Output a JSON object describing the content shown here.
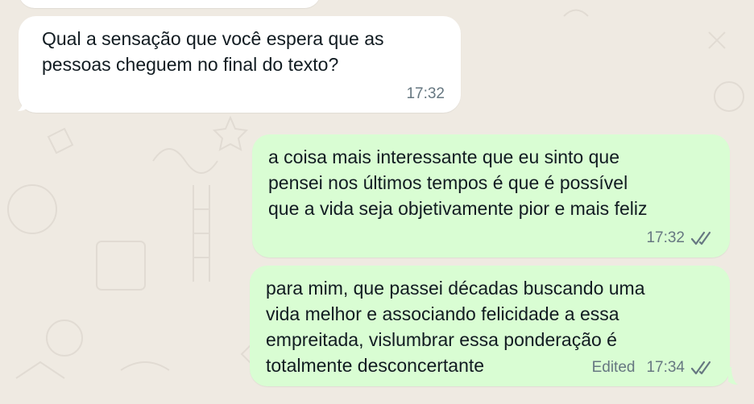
{
  "colors": {
    "wallpaper": "#efeae2",
    "incoming_bubble": "#ffffff",
    "outgoing_bubble": "#d9fdd3",
    "text": "#111b21",
    "meta": "#667781"
  },
  "messages": [
    {
      "direction": "incoming",
      "text": "Qual a sensação que você espera que as\npessoas cheguem no final do texto?",
      "time": "17:32"
    },
    {
      "direction": "outgoing",
      "text": "a coisa mais interessante que eu sinto que\npensei nos últimos tempos é que é possível\nque a vida seja objetivamente pior e mais feliz",
      "time": "17:32",
      "status_icon": "double-check-icon"
    },
    {
      "direction": "outgoing",
      "text": "para mim, que passei décadas buscando uma\nvida melhor e associando felicidade a essa\nempreitada, vislumbrar essa ponderação é\ntotalmente desconcertante",
      "edited_label": "Edited",
      "time": "17:34",
      "status_icon": "double-check-icon"
    }
  ]
}
